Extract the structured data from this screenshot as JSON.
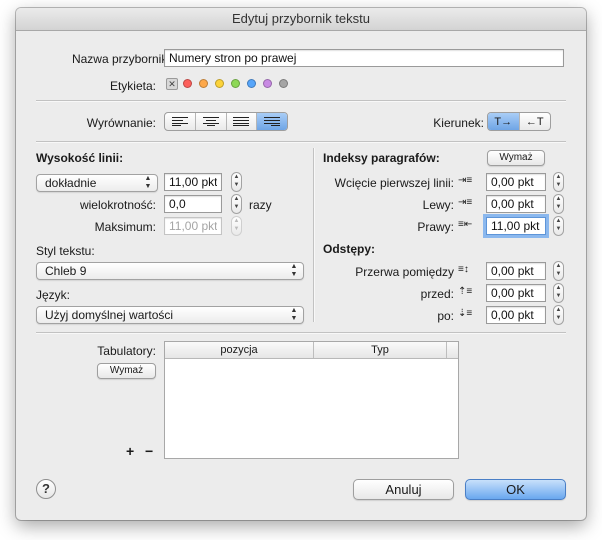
{
  "window": {
    "title": "Edytuj przybornik tekstu"
  },
  "name": {
    "label": "Nazwa przybornika",
    "value": "Numery stron po prawej"
  },
  "tags": {
    "label": "Etykieta:",
    "none_glyph": "✕",
    "colors": [
      "#fc605c",
      "#fda84a",
      "#fcd33a",
      "#8dd856",
      "#56a5fa",
      "#c88ae3",
      "#a5a5a5"
    ]
  },
  "alignment": {
    "label": "Wyrównanie:",
    "selected": "justify-right"
  },
  "direction": {
    "label": "Kierunek:",
    "ltr": "T→",
    "rtl": "←T",
    "selected": "ltr"
  },
  "line_height": {
    "heading": "Wysokość linii:",
    "mode": "dokładnie",
    "value": "11,00 pkt",
    "multiple_label": "wielokrotność:",
    "multiple_value": "0,0",
    "multiple_unit": "razy",
    "max_label": "Maksimum:",
    "max_value": "11,00 pkt"
  },
  "text_style": {
    "label": "Styl tekstu:",
    "value": "Chleb 9"
  },
  "language": {
    "label": "Język:",
    "value": "Użyj domyślnej wartości"
  },
  "indents": {
    "heading": "Indeksy paragrafów:",
    "clear_label": "Wymaż",
    "first_line_label": "Wcięcie pierwszej linii:",
    "first_line_value": "0,00 pkt",
    "left_label": "Lewy:",
    "left_value": "0,00 pkt",
    "right_label": "Prawy:",
    "right_value": "11,00 pkt"
  },
  "spacing": {
    "heading": "Odstępy:",
    "between_label": "Przerwa pomiędzy",
    "between_value": "0,00 pkt",
    "before_label": "przed:",
    "before_value": "0,00 pkt",
    "after_label": "po:",
    "after_value": "0,00 pkt"
  },
  "tabs": {
    "label": "Tabulatory:",
    "clear_label": "Wymaż",
    "columns": [
      "pozycja",
      "Typ"
    ],
    "rows": [],
    "add_label": "+",
    "remove_label": "−"
  },
  "footer": {
    "help_label": "?",
    "cancel_label": "Anuluj",
    "ok_label": "OK"
  }
}
